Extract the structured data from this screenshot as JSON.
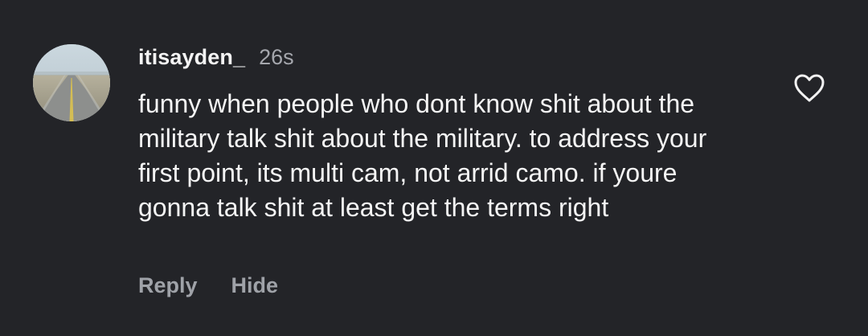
{
  "comment": {
    "username": "itisayden_",
    "timestamp": "26s",
    "text": "funny when people who dont know shit about the military talk shit about the military. to address your first point, its multi cam, not arrid camo. if youre gonna talk shit at least get the terms right",
    "actions": {
      "reply": "Reply",
      "hide": "Hide"
    },
    "icons": {
      "avatar": "road-photo",
      "like": "heart-outline-icon"
    },
    "colors": {
      "background": "#232428",
      "primary_text": "#f5f5f5",
      "secondary_text": "#a5a7ad",
      "action_text": "#9fa2a8"
    }
  }
}
